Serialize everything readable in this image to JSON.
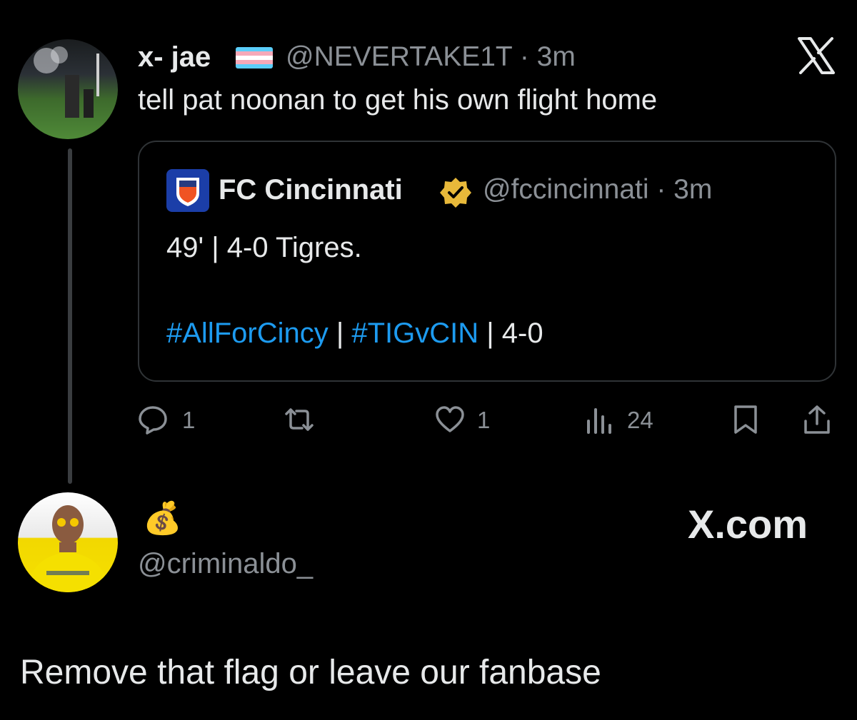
{
  "tweet": {
    "author_name": "x- jae",
    "author_handle": "@NEVERTAKE1T · 3m",
    "text": "tell pat noonan to get his own flight home",
    "brand_icon": "x-logo-icon"
  },
  "quote": {
    "author_name": "FC Cincinnati",
    "author_handle": "@fccincinnati · 3m",
    "line1": "49' | 4-0 Tigres.",
    "hashtag1": "#AllForCincy",
    "sep1": " | ",
    "hashtag2": "#TIGvCIN",
    "tail": " | 4-0"
  },
  "actions": {
    "replies": "1",
    "likes": "1",
    "views": "24"
  },
  "reply": {
    "emoji": "💰",
    "handle": "@criminaldo_",
    "watermark": "X.com",
    "text": "Remove that flag or leave our fanbase"
  },
  "colors": {
    "background": "#000000",
    "text": "#e7e9ea",
    "muted": "#8b9096",
    "link": "#1d9bf0",
    "border": "#2f3336",
    "verified": "#e8b93a"
  }
}
